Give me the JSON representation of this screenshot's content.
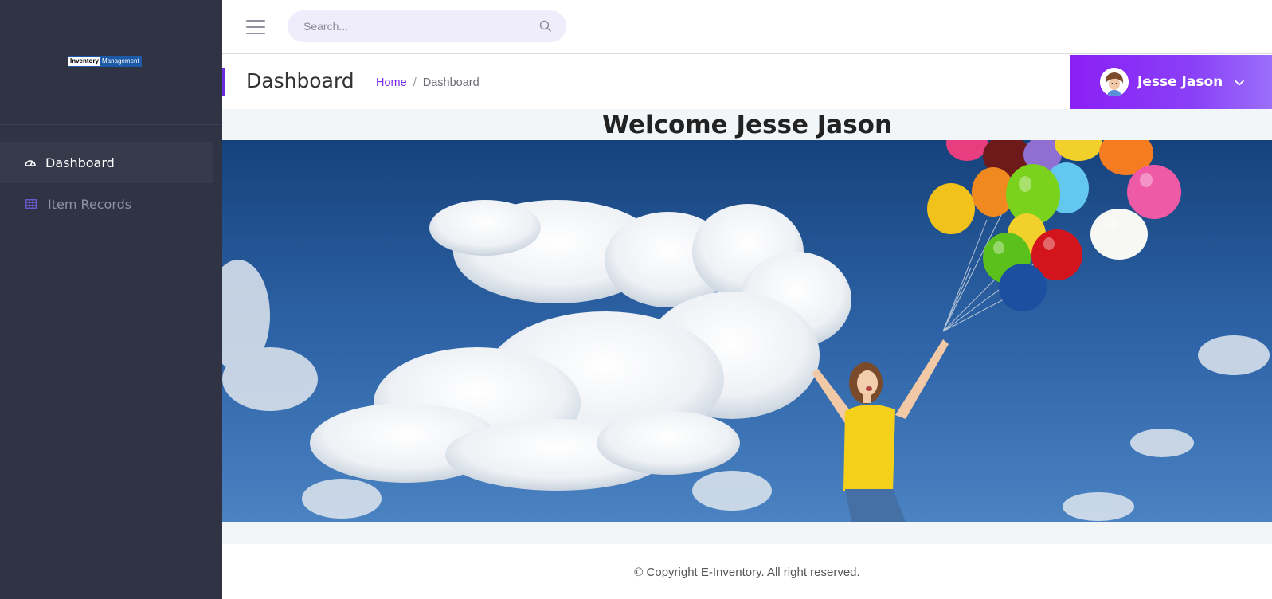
{
  "sidebar": {
    "logo": {
      "part1": "Inventory",
      "part2": "Management"
    },
    "items": [
      {
        "label": "Dashboard",
        "icon": "dashboard-gauge-icon",
        "active": true
      },
      {
        "label": "Item Records",
        "icon": "table-grid-icon",
        "active": false
      }
    ]
  },
  "topbar": {
    "search": {
      "placeholder": "Search...",
      "value": ""
    }
  },
  "header": {
    "title": "Dashboard",
    "breadcrumb": {
      "home": "Home",
      "separator": "/",
      "current": "Dashboard"
    }
  },
  "user": {
    "name": "Jesse Jason"
  },
  "welcome": {
    "prefix": "Welcome",
    "name": "Jesse Jason"
  },
  "footer": {
    "copyright": "© Copyright E-Inventory. All right reserved."
  },
  "colors": {
    "sidebar_bg": "#2f3344",
    "accent": "#7b2be8",
    "user_menu_gradient_start": "#8b1ff5",
    "user_menu_gradient_end": "#9b6ffb"
  }
}
